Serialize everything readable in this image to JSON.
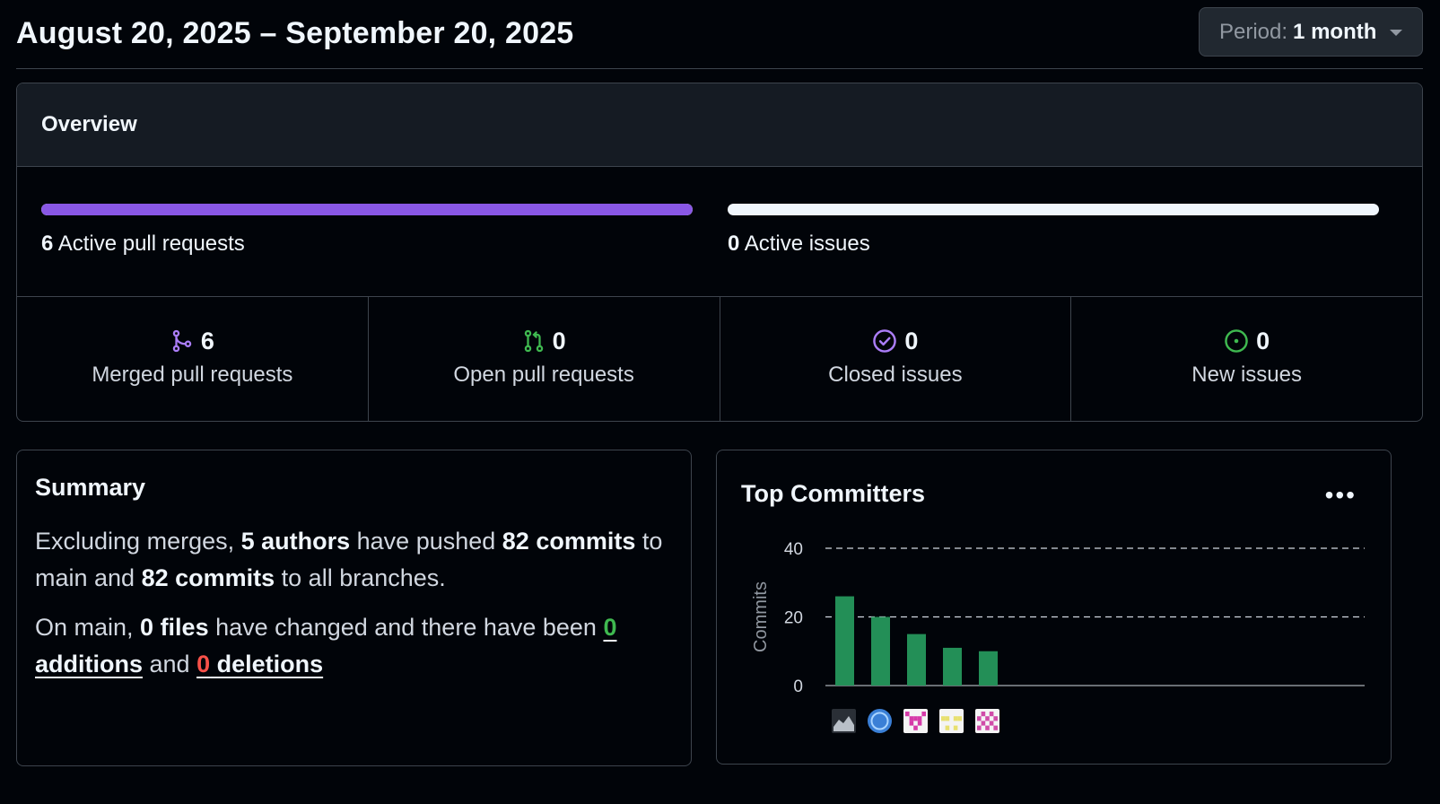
{
  "header": {
    "date_range": "August 20, 2025 – September 20, 2025",
    "period_label": "Period:",
    "period_value": "1 month"
  },
  "overview": {
    "title": "Overview",
    "active_prs": {
      "count": "6",
      "label": "Active pull requests",
      "fill_fraction": 1.0,
      "color": "#8957e5"
    },
    "active_issues": {
      "count": "0",
      "label": "Active issues",
      "fill_fraction": 0.0
    },
    "stats": [
      {
        "icon": "git-merge-icon",
        "value": "6",
        "label": "Merged pull requests",
        "color": "#ab7df8"
      },
      {
        "icon": "git-pull-request-icon",
        "value": "0",
        "label": "Open pull requests",
        "color": "#3fb950"
      },
      {
        "icon": "issue-closed-icon",
        "value": "0",
        "label": "Closed issues",
        "color": "#ab7df8"
      },
      {
        "icon": "issue-opened-icon",
        "value": "0",
        "label": "New issues",
        "color": "#3fb950"
      }
    ]
  },
  "summary": {
    "title": "Summary",
    "p1": {
      "t1": "Excluding merges, ",
      "authors": "5 authors",
      "t2": " have pushed ",
      "commits_main": "82 commits",
      "t3": " to main and ",
      "commits_all": "82 commits",
      "t4": " to all branches."
    },
    "p2": {
      "t1": "On main, ",
      "files": "0 files",
      "t2": " have changed and there have been ",
      "additions_num": "0",
      "additions_word": " additions",
      "t3": " and ",
      "deletions_num": "0",
      "deletions_word": " deletions"
    }
  },
  "committers": {
    "title": "Top Committers",
    "menu_icon": "kebab-horizontal-icon",
    "chart_data": {
      "type": "bar",
      "ylabel": "Commits",
      "ylim": [
        0,
        40
      ],
      "yticks": [
        "0",
        "20",
        "40"
      ],
      "grid": "dashed horizontal",
      "bar_color": "#238f57",
      "values": [
        26,
        20,
        15,
        11,
        10
      ],
      "avatars": [
        {
          "icon": "avatar-photo-icon"
        },
        {
          "icon": "avatar-globe-icon"
        },
        {
          "icon": "avatar-identicon-magenta"
        },
        {
          "icon": "avatar-identicon-yellow"
        },
        {
          "icon": "avatar-identicon-pink"
        }
      ]
    }
  }
}
